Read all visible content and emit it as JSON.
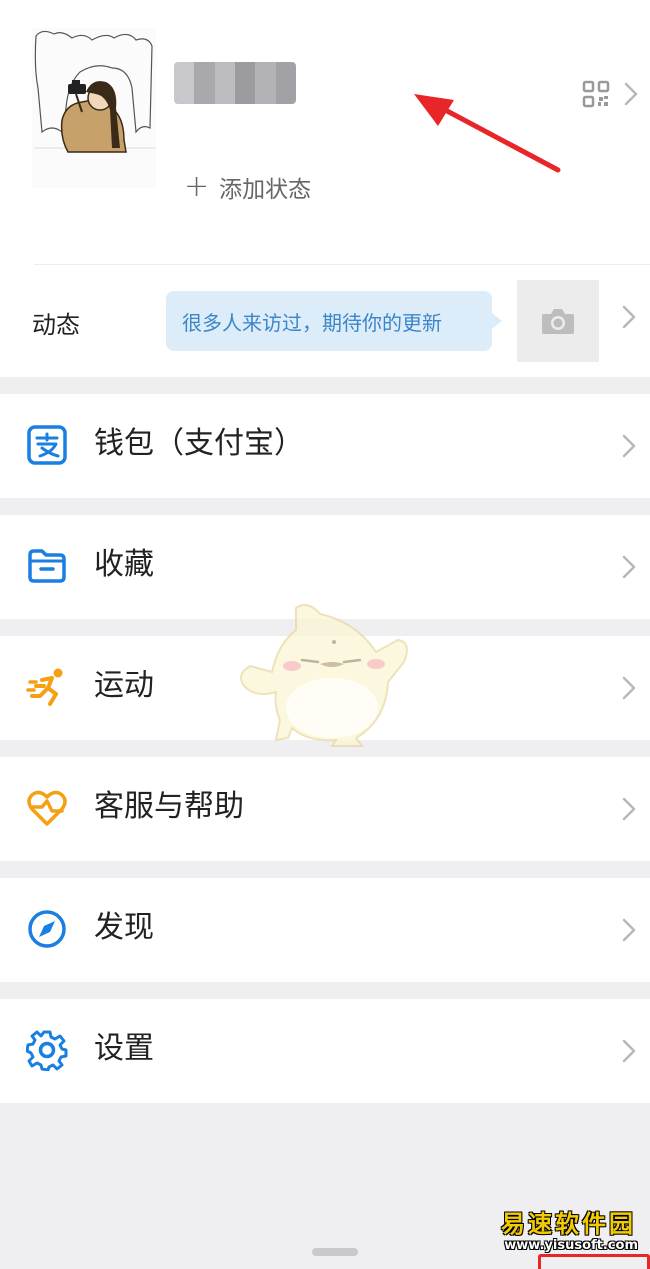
{
  "profile": {
    "nickname": "(blurred)",
    "add_status": "添加状态",
    "qr_icon": "qr-code-icon",
    "arrow_icon": "chevron-right-icon"
  },
  "moments": {
    "label": "动态",
    "bubble_text": "很多人来访过，期待你的更新",
    "camera_icon": "camera-icon"
  },
  "menu": [
    {
      "label": "钱包（支付宝）",
      "icon": "alipay-icon",
      "color": "#1a7fe0"
    },
    {
      "label": "收藏",
      "icon": "folder-icon",
      "color": "#1a7fe0"
    },
    {
      "label": "运动",
      "icon": "running-icon",
      "color": "#f5a013"
    },
    {
      "label": "客服与帮助",
      "icon": "heart-support-icon",
      "color": "#f5a013"
    },
    {
      "label": "发现",
      "icon": "compass-icon",
      "color": "#1a7fe0"
    },
    {
      "label": "设置",
      "icon": "gear-icon",
      "color": "#1a7fe0"
    }
  ],
  "watermark": {
    "title": "易速软件园",
    "url": "www.yisusoft.com"
  },
  "colors": {
    "accent_blue": "#1a7fe0",
    "accent_orange": "#f5a013",
    "annotation_red": "#e8262a",
    "bubble_bg": "#dcedf9",
    "bubble_text": "#3b86c8"
  }
}
